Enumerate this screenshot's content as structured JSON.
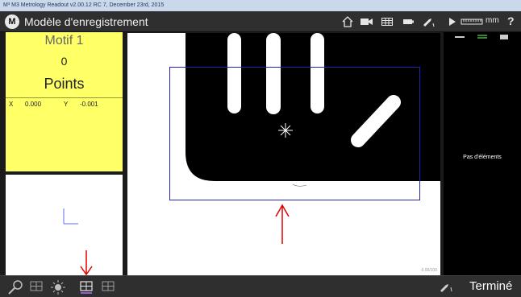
{
  "window": {
    "os_title": "M³ M3 Metrology Readout v2.00.12 RC 7, December 23rd, 2015"
  },
  "header": {
    "logo_text": "M",
    "title": "Modèle d'enregistrement",
    "icons": [
      "home-icon",
      "video-camera-icon",
      "grid-icon",
      "battery-icon",
      "probe-icon",
      "play-icon",
      "scale-ruler-icon"
    ],
    "unit": "mm",
    "help": "?"
  },
  "feature_panel": {
    "name": "Motif 1",
    "count": "0",
    "count_label": "Points",
    "x_label": "X",
    "x_value": "0.000",
    "y_label": "Y",
    "y_value": "-0.001",
    "background": "#ffff66"
  },
  "right_panel": {
    "empty_text": "Pas d'éléments"
  },
  "camera": {
    "scale_text": "0.00/100"
  },
  "bottom_bar": {
    "left_icons": [
      "measure-tool-icon",
      "grid-tool-icon",
      "light-icon",
      "pattern-record-icon",
      "pattern-grid-icon"
    ],
    "probe_icon": "probe-icon",
    "done_label": "Terminé"
  },
  "colors": {
    "accent_annotation": "#e00000",
    "roi_border": "#2222bb",
    "panel_highlight": "#ffff66"
  }
}
